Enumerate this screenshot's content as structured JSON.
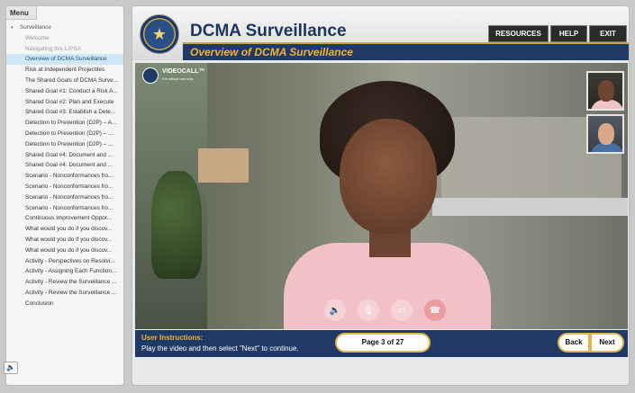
{
  "sidebar": {
    "tab_label": "Menu",
    "items": [
      {
        "label": "Surveillance",
        "type": "section"
      },
      {
        "label": "Welcome",
        "type": "muted"
      },
      {
        "label": "Navigating this L/PSA",
        "type": "muted"
      },
      {
        "label": "Overview of DCMA Surveillance",
        "type": "active"
      },
      {
        "label": "Risk at Independent Projectiles",
        "type": "plain"
      },
      {
        "label": "The Shared Goals of DCMA Surve...",
        "type": "plain"
      },
      {
        "label": "Shared Goal #1: Conduct a Risk A...",
        "type": "plain"
      },
      {
        "label": "Shared Goal #2: Plan and Execute",
        "type": "plain"
      },
      {
        "label": "Shared Goal #3: Establish a Dete...",
        "type": "plain"
      },
      {
        "label": "Detection to Prevention (D2P) – A...",
        "type": "plain"
      },
      {
        "label": "Detection to Prevention (D2P) – ...",
        "type": "plain"
      },
      {
        "label": "Detection to Prevention (D2P) – ...",
        "type": "plain"
      },
      {
        "label": "Shared Goal #4: Document and ...",
        "type": "plain"
      },
      {
        "label": "Shared Goal #4: Document and ...",
        "type": "plain"
      },
      {
        "label": "Scenario - Nonconformances fro...",
        "type": "plain"
      },
      {
        "label": "Scenario - Nonconformances fro...",
        "type": "plain"
      },
      {
        "label": "Scenario - Nonconformances fro...",
        "type": "plain"
      },
      {
        "label": "Scenario - Nonconformances fro...",
        "type": "plain"
      },
      {
        "label": "Continuous Improvement Oppor...",
        "type": "plain"
      },
      {
        "label": "What would you do if you discov...",
        "type": "plain"
      },
      {
        "label": "What would you do if you discov...",
        "type": "plain"
      },
      {
        "label": "What would you do if you discov...",
        "type": "plain"
      },
      {
        "label": "Activity - Perspectives on Resolvi...",
        "type": "plain"
      },
      {
        "label": "Activity - Assigning Each Function...",
        "type": "plain"
      },
      {
        "label": "Activity - Review the Surveillance ...",
        "type": "plain"
      },
      {
        "label": "Activity - Review the Surveillance ...",
        "type": "plain"
      },
      {
        "label": "Conclusion",
        "type": "plain"
      }
    ]
  },
  "header": {
    "title": "DCMA Surveillance",
    "subtitle": "Overview of DCMA Surveillance",
    "buttons": {
      "resources": "RESOURCES",
      "help": "HELP",
      "exit": "EXIT"
    }
  },
  "video": {
    "logo_text": "VIDEOCALL™",
    "logo_sub": "For official use only."
  },
  "footer": {
    "instructions_label": "User Instructions:",
    "instructions_text": "Play the video and then select \"Next\" to continue.",
    "page_indicator": "Page 3 of 27",
    "back_label": "Back",
    "next_label": "Next"
  },
  "colors": {
    "navy": "#1f3a66",
    "gold": "#f0b43c",
    "active_item_bg": "#cfe6f5"
  }
}
